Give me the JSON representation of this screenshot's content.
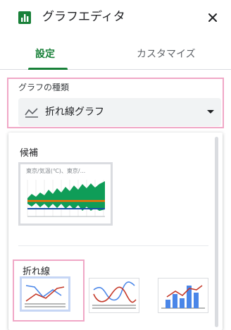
{
  "header": {
    "title": "グラフエディタ",
    "icon": "chart-icon",
    "close_icon": "close-icon"
  },
  "tabs": [
    {
      "label": "設定",
      "active": true
    },
    {
      "label": "カスタマイズ",
      "active": false
    }
  ],
  "chart_type": {
    "label": "グラフの種類",
    "selected": "折れ線グラフ",
    "icon": "line-chart-icon"
  },
  "dropdown": {
    "suggestions_label": "候補",
    "suggestion_thumb_title": "東京/気温(℃)、東京/...",
    "line_section_label": "折れ線",
    "line_thumbnails": [
      "line-chart",
      "smooth-line-chart",
      "combo-chart"
    ]
  },
  "colors": {
    "accent": "#188038",
    "highlight": "#f0a7c6",
    "blue": "#4a86e8",
    "red": "#c53929"
  }
}
